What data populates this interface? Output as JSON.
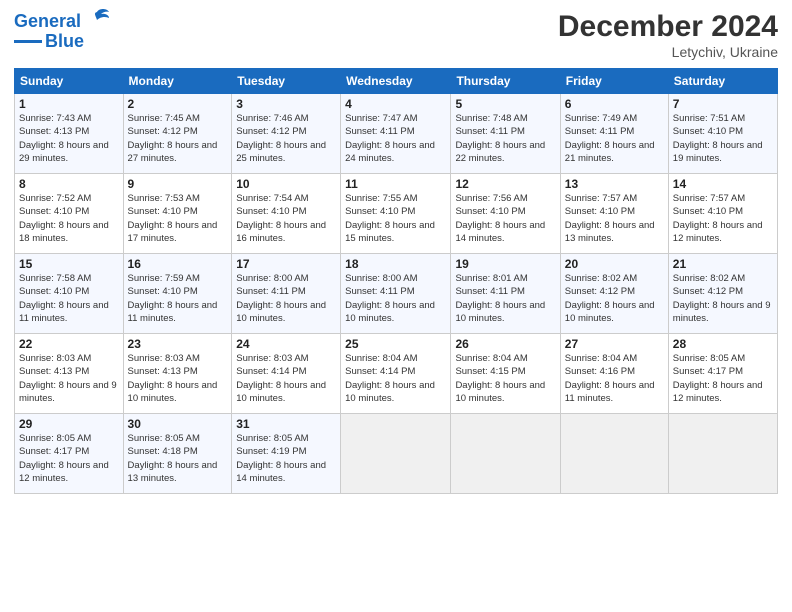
{
  "header": {
    "logo_line1": "General",
    "logo_line2": "Blue",
    "month": "December 2024",
    "location": "Letychiv, Ukraine"
  },
  "weekdays": [
    "Sunday",
    "Monday",
    "Tuesday",
    "Wednesday",
    "Thursday",
    "Friday",
    "Saturday"
  ],
  "weeks": [
    [
      {
        "day": "1",
        "sunrise": "7:43 AM",
        "sunset": "4:13 PM",
        "daylight": "8 hours and 29 minutes."
      },
      {
        "day": "2",
        "sunrise": "7:45 AM",
        "sunset": "4:12 PM",
        "daylight": "8 hours and 27 minutes."
      },
      {
        "day": "3",
        "sunrise": "7:46 AM",
        "sunset": "4:12 PM",
        "daylight": "8 hours and 25 minutes."
      },
      {
        "day": "4",
        "sunrise": "7:47 AM",
        "sunset": "4:11 PM",
        "daylight": "8 hours and 24 minutes."
      },
      {
        "day": "5",
        "sunrise": "7:48 AM",
        "sunset": "4:11 PM",
        "daylight": "8 hours and 22 minutes."
      },
      {
        "day": "6",
        "sunrise": "7:49 AM",
        "sunset": "4:11 PM",
        "daylight": "8 hours and 21 minutes."
      },
      {
        "day": "7",
        "sunrise": "7:51 AM",
        "sunset": "4:10 PM",
        "daylight": "8 hours and 19 minutes."
      }
    ],
    [
      {
        "day": "8",
        "sunrise": "7:52 AM",
        "sunset": "4:10 PM",
        "daylight": "8 hours and 18 minutes."
      },
      {
        "day": "9",
        "sunrise": "7:53 AM",
        "sunset": "4:10 PM",
        "daylight": "8 hours and 17 minutes."
      },
      {
        "day": "10",
        "sunrise": "7:54 AM",
        "sunset": "4:10 PM",
        "daylight": "8 hours and 16 minutes."
      },
      {
        "day": "11",
        "sunrise": "7:55 AM",
        "sunset": "4:10 PM",
        "daylight": "8 hours and 15 minutes."
      },
      {
        "day": "12",
        "sunrise": "7:56 AM",
        "sunset": "4:10 PM",
        "daylight": "8 hours and 14 minutes."
      },
      {
        "day": "13",
        "sunrise": "7:57 AM",
        "sunset": "4:10 PM",
        "daylight": "8 hours and 13 minutes."
      },
      {
        "day": "14",
        "sunrise": "7:57 AM",
        "sunset": "4:10 PM",
        "daylight": "8 hours and 12 minutes."
      }
    ],
    [
      {
        "day": "15",
        "sunrise": "7:58 AM",
        "sunset": "4:10 PM",
        "daylight": "8 hours and 11 minutes."
      },
      {
        "day": "16",
        "sunrise": "7:59 AM",
        "sunset": "4:10 PM",
        "daylight": "8 hours and 11 minutes."
      },
      {
        "day": "17",
        "sunrise": "8:00 AM",
        "sunset": "4:11 PM",
        "daylight": "8 hours and 10 minutes."
      },
      {
        "day": "18",
        "sunrise": "8:00 AM",
        "sunset": "4:11 PM",
        "daylight": "8 hours and 10 minutes."
      },
      {
        "day": "19",
        "sunrise": "8:01 AM",
        "sunset": "4:11 PM",
        "daylight": "8 hours and 10 minutes."
      },
      {
        "day": "20",
        "sunrise": "8:02 AM",
        "sunset": "4:12 PM",
        "daylight": "8 hours and 10 minutes."
      },
      {
        "day": "21",
        "sunrise": "8:02 AM",
        "sunset": "4:12 PM",
        "daylight": "8 hours and 9 minutes."
      }
    ],
    [
      {
        "day": "22",
        "sunrise": "8:03 AM",
        "sunset": "4:13 PM",
        "daylight": "8 hours and 9 minutes."
      },
      {
        "day": "23",
        "sunrise": "8:03 AM",
        "sunset": "4:13 PM",
        "daylight": "8 hours and 10 minutes."
      },
      {
        "day": "24",
        "sunrise": "8:03 AM",
        "sunset": "4:14 PM",
        "daylight": "8 hours and 10 minutes."
      },
      {
        "day": "25",
        "sunrise": "8:04 AM",
        "sunset": "4:14 PM",
        "daylight": "8 hours and 10 minutes."
      },
      {
        "day": "26",
        "sunrise": "8:04 AM",
        "sunset": "4:15 PM",
        "daylight": "8 hours and 10 minutes."
      },
      {
        "day": "27",
        "sunrise": "8:04 AM",
        "sunset": "4:16 PM",
        "daylight": "8 hours and 11 minutes."
      },
      {
        "day": "28",
        "sunrise": "8:05 AM",
        "sunset": "4:17 PM",
        "daylight": "8 hours and 12 minutes."
      }
    ],
    [
      {
        "day": "29",
        "sunrise": "8:05 AM",
        "sunset": "4:17 PM",
        "daylight": "8 hours and 12 minutes."
      },
      {
        "day": "30",
        "sunrise": "8:05 AM",
        "sunset": "4:18 PM",
        "daylight": "8 hours and 13 minutes."
      },
      {
        "day": "31",
        "sunrise": "8:05 AM",
        "sunset": "4:19 PM",
        "daylight": "8 hours and 14 minutes."
      },
      null,
      null,
      null,
      null
    ]
  ]
}
